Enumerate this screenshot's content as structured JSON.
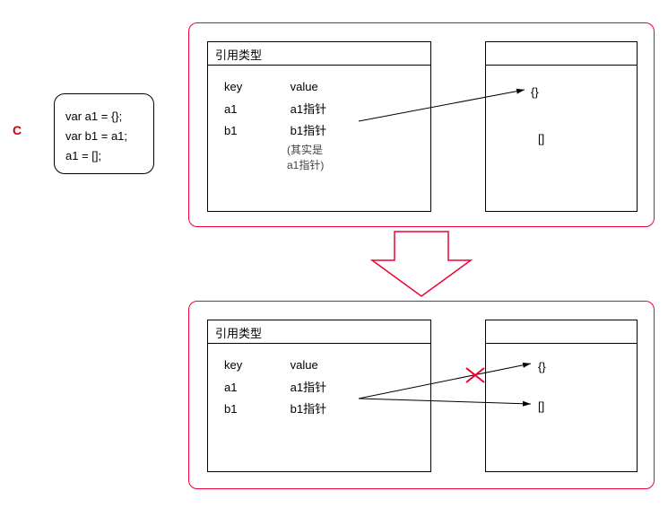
{
  "label": "C",
  "code": {
    "line1": "var a1 = {};",
    "line2": "var b1 = a1;",
    "line3": "a1 = [];"
  },
  "panel1": {
    "title": "引用类型",
    "header_key": "key",
    "header_value": "value",
    "row1_key": "a1",
    "row1_value": "a1指针",
    "row2_key": "b1",
    "row2_value": "b1指针",
    "note1": "(其实是",
    "note2": "a1指针)"
  },
  "heap1": {
    "obj": "{}",
    "arr": "[]"
  },
  "panel2": {
    "title": "引用类型",
    "header_key": "key",
    "header_value": "value",
    "row1_key": "a1",
    "row1_value": "a1指针",
    "row2_key": "b1",
    "row2_value": "b1指针"
  },
  "heap2": {
    "obj": "{}",
    "arr": "[]"
  }
}
